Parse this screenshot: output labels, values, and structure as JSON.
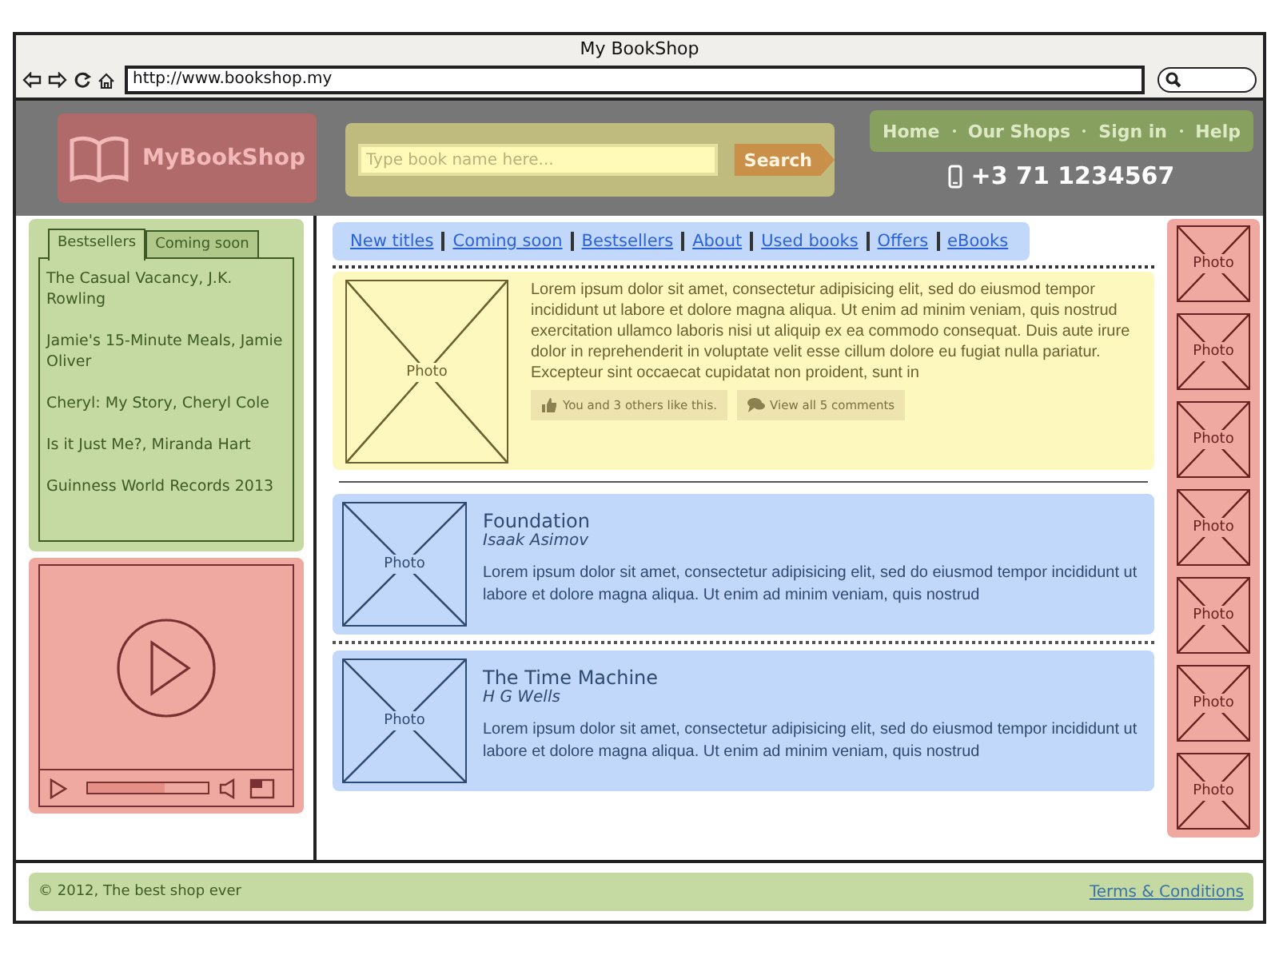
{
  "window": {
    "title": "My BookShop"
  },
  "browser": {
    "url": "http://www.bookshop.my"
  },
  "header": {
    "logo": "MyBookShop",
    "search": {
      "placeholder": "Type book name here...",
      "button": "Search"
    },
    "nav": [
      "Home",
      "Our Shops",
      "Sign in",
      "Help"
    ],
    "phone": "+3 71 1234567"
  },
  "sidebar": {
    "tabs": [
      {
        "label": "Bestsellers",
        "selected": true
      },
      {
        "label": "Coming soon",
        "selected": false
      }
    ],
    "books": [
      "The Casual Vacancy, J.K. Rowling",
      "Jamie's 15-Minute Meals, Jamie Oliver",
      "Cheryl: My Story, Cheryl Cole",
      "Is it Just Me?, Miranda Hart",
      "Guinness World Records 2013"
    ],
    "video": {
      "level": 0.64
    }
  },
  "links": [
    "New titles",
    "Coming soon",
    "Bestsellers",
    "About",
    "Used books",
    "Offers",
    "eBooks"
  ],
  "featured": {
    "photo": "Photo",
    "text": "Lorem ipsum dolor sit amet, consectetur adipisicing elit, sed do eiusmod tempor incididunt ut labore et dolore magna aliqua. Ut enim ad minim veniam, quis nostrud exercitation ullamco laboris nisi ut aliquip ex ea commodo consequat. Duis aute irure dolor in reprehenderit in voluptate velit esse cillum dolore eu fugiat nulla pariatur. Excepteur sint occaecat cupidatat non proident, sunt in",
    "actions": [
      {
        "kind": "like",
        "label": "You and 3 others like this."
      },
      {
        "kind": "comments",
        "label": "View all 5 comments"
      }
    ]
  },
  "books": [
    {
      "photo": "Photo",
      "title": "Foundation",
      "author": "Isaak Asimov",
      "text": "Lorem ipsum dolor sit amet, consectetur adipisicing elit, sed do eiusmod tempor incididunt ut labore et dolore magna aliqua. Ut enim ad minim veniam, quis nostrud"
    },
    {
      "photo": "Photo",
      "title": "The Time Machine",
      "author": "H G Wells",
      "text": "Lorem ipsum dolor sit amet, consectetur adipisicing elit, sed do eiusmod tempor incididunt ut labore et dolore magna aliqua. Ut enim ad minim veniam, quis nostrud"
    }
  ],
  "right_column": {
    "photos": [
      "Photo",
      "Photo",
      "Photo",
      "Photo",
      "Photo",
      "Photo",
      "Photo"
    ]
  },
  "footer": {
    "text": "© 2012, The best shop ever",
    "link": "Terms & Conditions"
  }
}
